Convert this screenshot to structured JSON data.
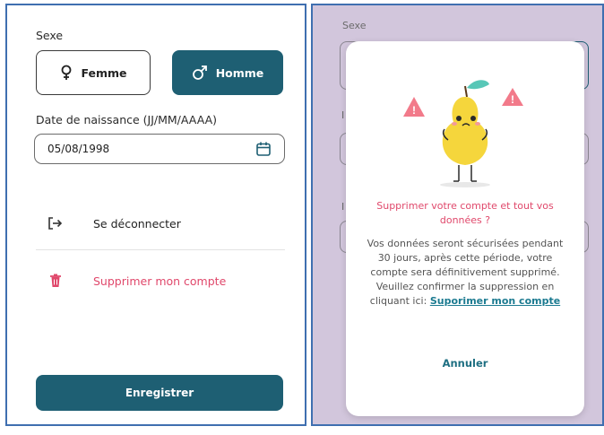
{
  "left": {
    "sexe_label": "Sexe",
    "femme_label": "Femme",
    "homme_label": "Homme",
    "dob_label": "Date de naissance (JJ/MM/AAAA)",
    "dob_value": "05/08/1998",
    "logout_label": "Se déconnecter",
    "delete_label": "Supprimer mon compte",
    "save_label": "Enregistrer",
    "icons": {
      "female": "female-symbol-icon",
      "male": "male-symbol-icon",
      "calendar": "calendar-icon",
      "logout": "logout-icon",
      "trash": "trash-icon"
    },
    "colors": {
      "primary": "#1e5f73",
      "danger": "#e0486b"
    }
  },
  "right": {
    "sexe_label": "Sexe",
    "modal": {
      "title": "Supprimer votre compte et tout vos données ?",
      "body": "Vos données seront sécurisées pendant 30 jours, après cette période, votre compte sera définitivement supprimé. Veuillez confirmer la suppression en cliquant ici:",
      "link": "Suporimer mon compte",
      "cancel": "Annuler",
      "illustration": "pear-mascot-illustration"
    }
  }
}
